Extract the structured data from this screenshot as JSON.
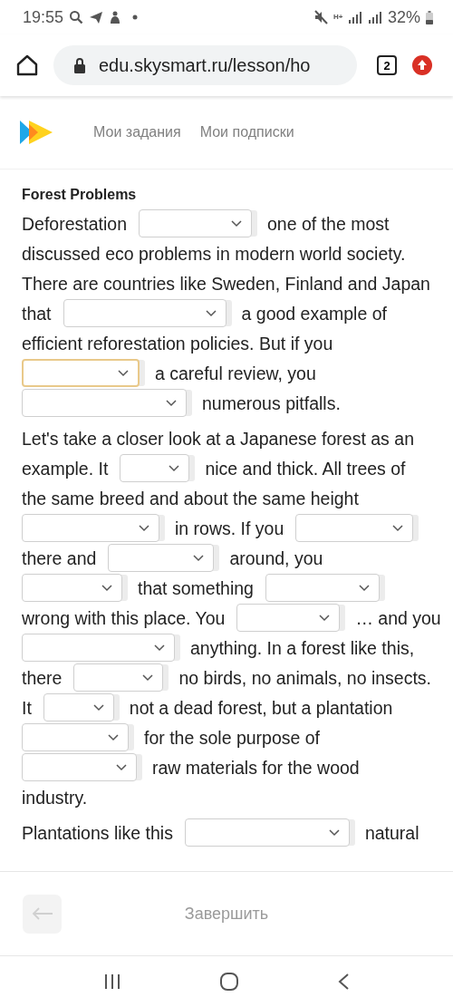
{
  "status_bar": {
    "time": "19:55",
    "network": "H+",
    "battery": "32%"
  },
  "browser": {
    "url": "edu.skysmart.ru/lesson/ho",
    "tab_count": "2"
  },
  "header": {
    "nav": [
      {
        "label": "Мои задания"
      },
      {
        "label": "Мои подписки"
      }
    ]
  },
  "lesson": {
    "title": "Forest Problems",
    "paragraphs": [
      {
        "lines": [
          [
            {
              "kind": "text",
              "text": "Deforestation"
            },
            {
              "kind": "dropdown",
              "focused": false
            },
            {
              "kind": "text",
              "text": "one of the most"
            }
          ],
          [
            {
              "kind": "text",
              "text": "discussed eco problems in modern world society."
            }
          ],
          [
            {
              "kind": "text",
              "text": "There are countries like Sweden, Finland and Japan"
            }
          ],
          [
            {
              "kind": "text",
              "text": "that"
            },
            {
              "kind": "dropdown",
              "focused": false
            },
            {
              "kind": "text",
              "text": "a good example of"
            }
          ],
          [
            {
              "kind": "text",
              "text": "efficient reforestation policies. But if you"
            }
          ],
          [
            {
              "kind": "dropdown",
              "focused": true
            },
            {
              "kind": "text",
              "text": "a careful review, you"
            }
          ],
          [
            {
              "kind": "dropdown",
              "focused": false
            },
            {
              "kind": "text",
              "text": "numerous pitfalls."
            }
          ]
        ]
      },
      {
        "lines": [
          [
            {
              "kind": "text",
              "text": "Let's take a closer look at a Japanese forest as an"
            }
          ],
          [
            {
              "kind": "text",
              "text": "example. It"
            },
            {
              "kind": "dropdown",
              "focused": false
            },
            {
              "kind": "text",
              "text": "nice and thick. All trees of"
            }
          ],
          [
            {
              "kind": "text",
              "text": "the same breed and about the same height"
            }
          ],
          [
            {
              "kind": "dropdown",
              "focused": false
            },
            {
              "kind": "text",
              "text": "in rows. If you"
            },
            {
              "kind": "dropdown",
              "focused": false
            }
          ],
          [
            {
              "kind": "text",
              "text": "there and"
            },
            {
              "kind": "dropdown",
              "focused": false
            },
            {
              "kind": "text",
              "text": "around, you"
            }
          ],
          [
            {
              "kind": "dropdown",
              "focused": false
            },
            {
              "kind": "text",
              "text": "that something"
            },
            {
              "kind": "dropdown",
              "focused": false
            }
          ],
          [
            {
              "kind": "text",
              "text": "wrong with this place. You"
            },
            {
              "kind": "dropdown",
              "focused": false
            },
            {
              "kind": "text",
              "text": "… and you"
            }
          ],
          [
            {
              "kind": "dropdown",
              "focused": false
            },
            {
              "kind": "text",
              "text": "anything. In a forest like this,"
            }
          ],
          [
            {
              "kind": "text",
              "text": "there"
            },
            {
              "kind": "dropdown",
              "focused": false
            },
            {
              "kind": "text",
              "text": "no birds, no animals, no insects."
            }
          ],
          [
            {
              "kind": "text",
              "text": "It"
            },
            {
              "kind": "dropdown",
              "focused": false
            },
            {
              "kind": "text",
              "text": "not a dead forest, but a plantation"
            }
          ],
          [
            {
              "kind": "dropdown",
              "focused": false
            },
            {
              "kind": "text",
              "text": "for the sole purpose of"
            }
          ],
          [
            {
              "kind": "dropdown",
              "focused": false
            },
            {
              "kind": "text",
              "text": "raw materials for the wood"
            }
          ],
          [
            {
              "kind": "text",
              "text": "industry."
            }
          ]
        ]
      },
      {
        "lines": [
          [
            {
              "kind": "text",
              "text": "Plantations like this"
            },
            {
              "kind": "dropdown",
              "focused": false
            },
            {
              "kind": "text",
              "text": "natural"
            }
          ]
        ]
      }
    ]
  },
  "footer": {
    "finish_button": "Завершить"
  }
}
